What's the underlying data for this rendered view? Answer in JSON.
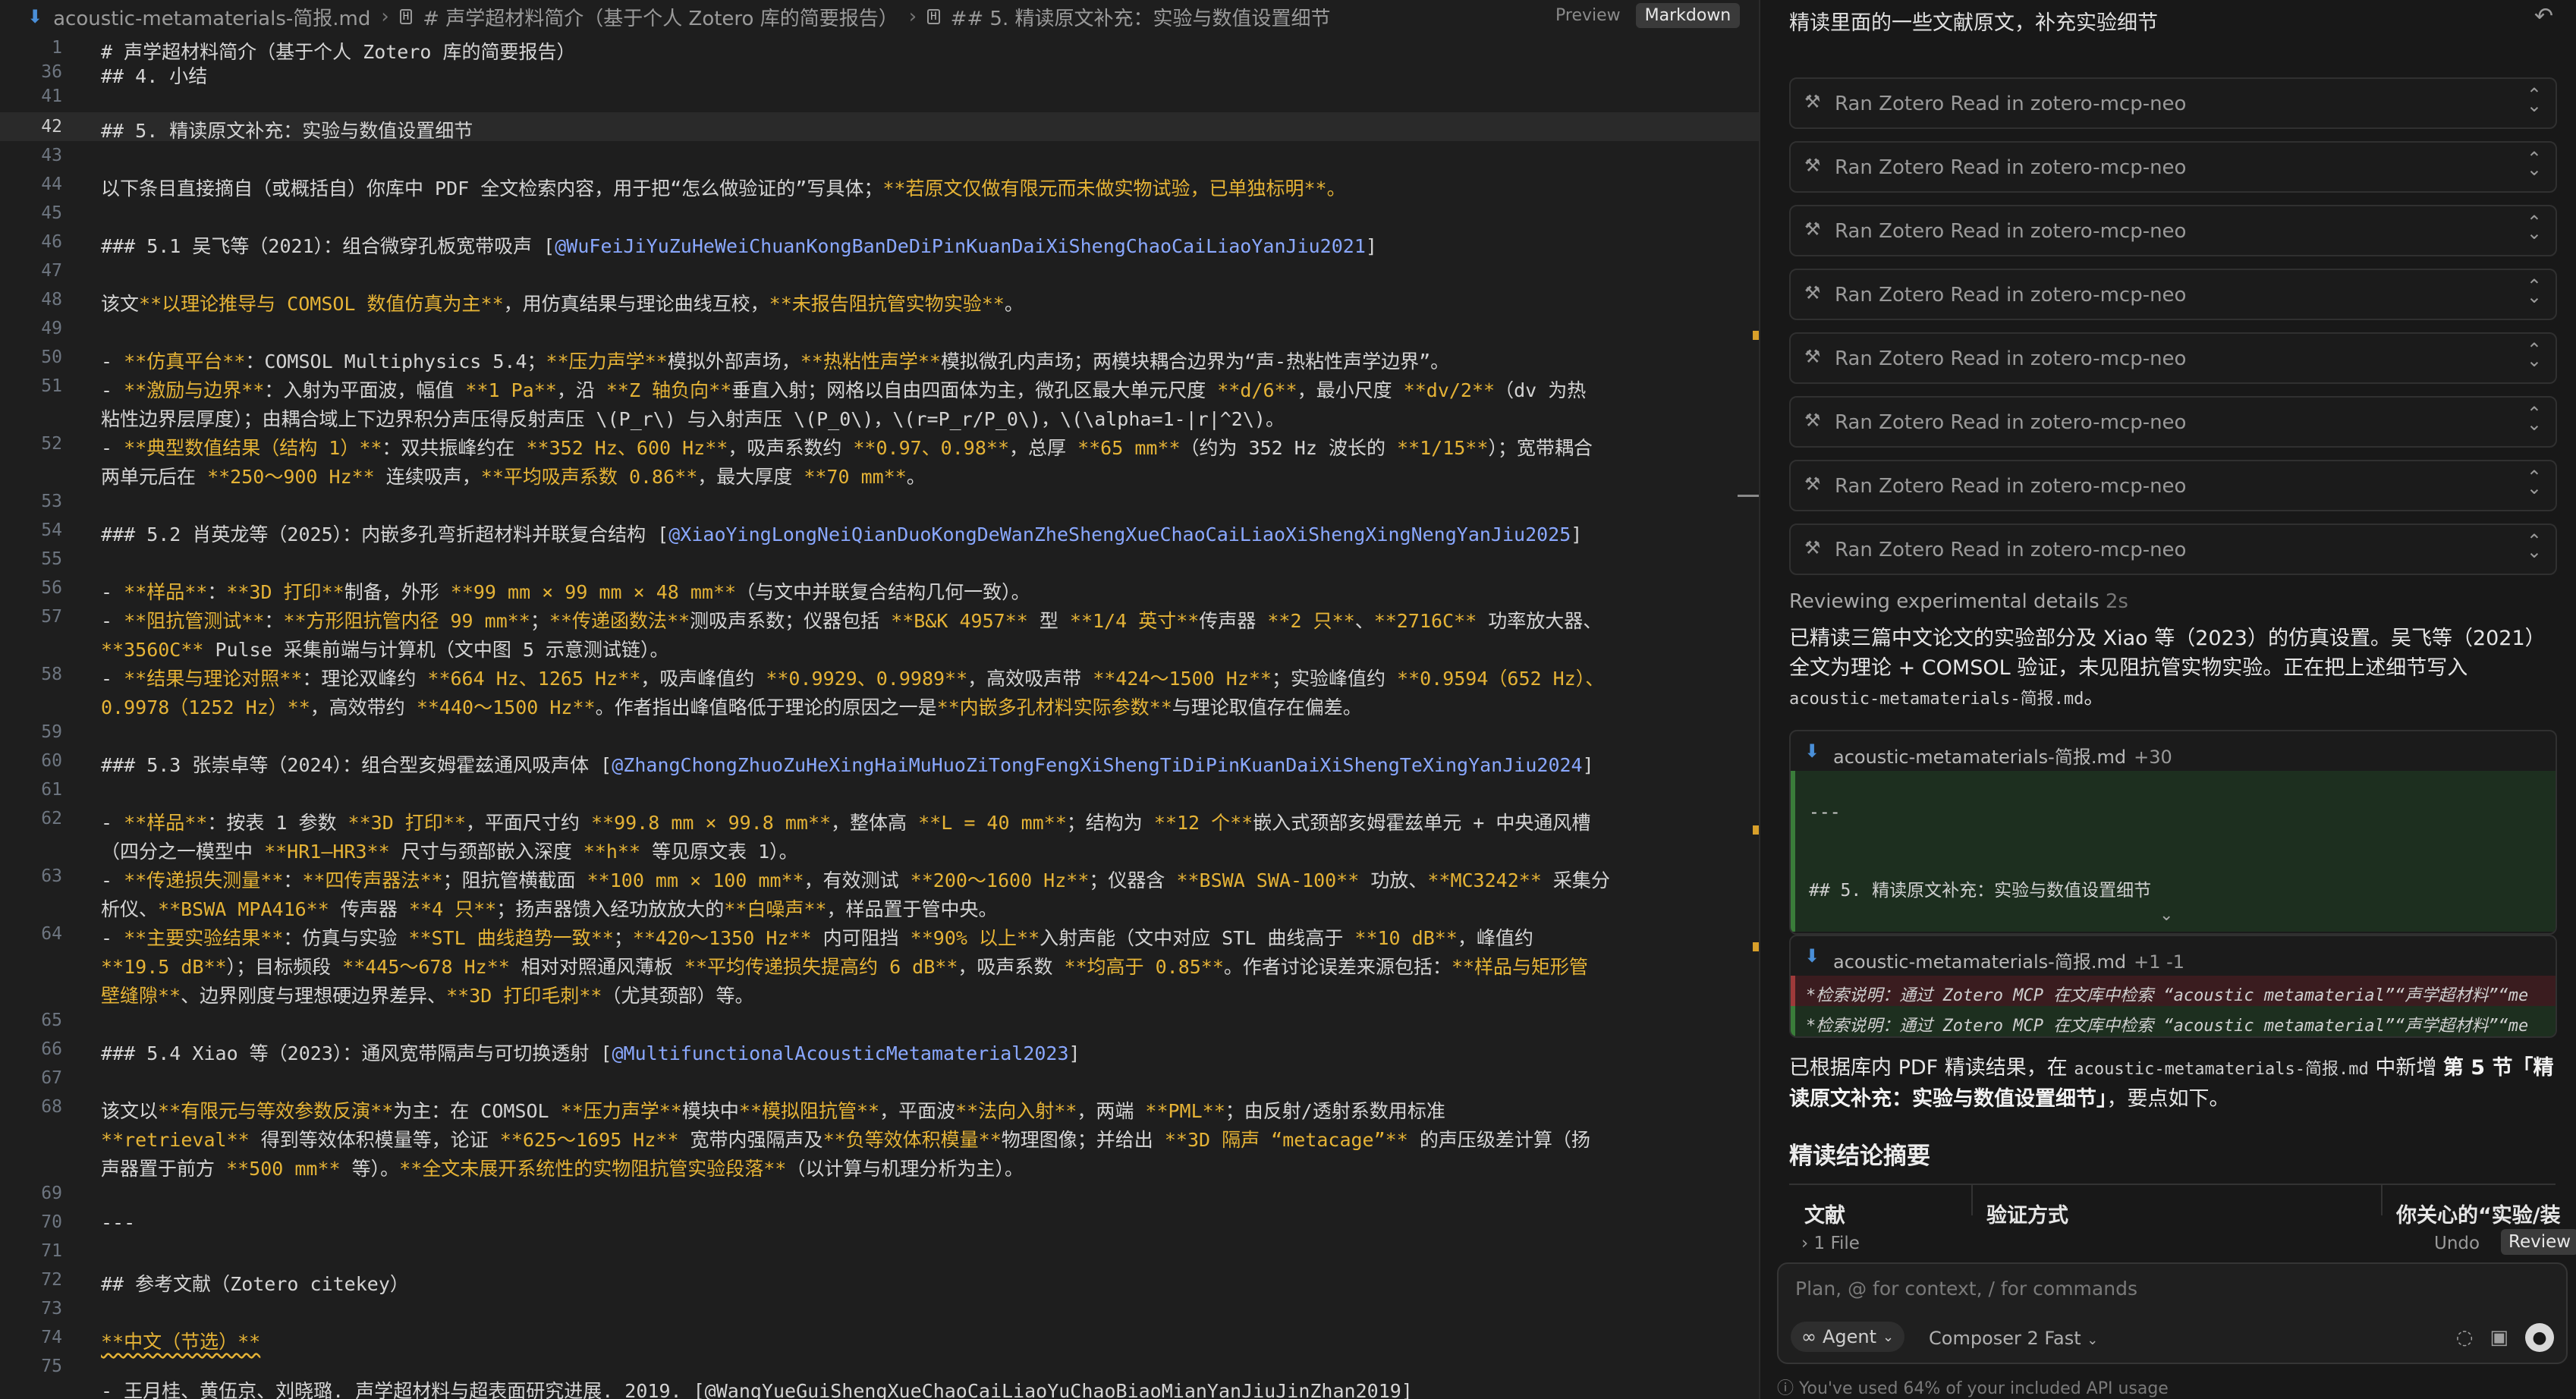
{
  "editor": {
    "breadcrumb": {
      "file": "acoustic-metamaterials-简报.md",
      "section1": "# 声学超材料简介（基于个人 Zotero 库的简要报告）",
      "section2": "## 5. 精读原文补充：实验与数值设置细节"
    },
    "view_toggle": {
      "preview": "Preview",
      "markdown": "Markdown"
    },
    "lines": {
      "l1": "# 声学超材料简介（基于个人 Zotero 库的简要报告）",
      "l36": "## 4. 小结",
      "l42": "## 5. 精读原文补充：实验与数值设置细节",
      "l44a": "以下条目直接摘自（或概括自）你库中 PDF 全文检索内容，用于把“怎么做验证的”写具体；",
      "l44b": "**若原文仅做有限元而未做实物试验，已单独标明**。",
      "l46a": "### 5.1 吴飞等（2021）：组合微穿孔板宽带吸声 [",
      "l46b": "@WuFeiJiYuZuHeWeiChuanKongBanDeDiPinKuanDaiXiShengChaoCaiLiaoYanJiu2021",
      "l46c": "]",
      "l48a": "该文",
      "l48b": "**以理论推导与 COMSOL 数值仿真为主**",
      "l48c": "，用仿真结果与理论曲线互校，",
      "l48d": "**未报告阻抗管实物实验**",
      "l48e": "。",
      "l50a": "- ",
      "l50b": "**仿真平台**",
      "l50c": "：COMSOL Multiphysics 5.4；",
      "l50d": "**压力声学**",
      "l50e": "模拟外部声场，",
      "l50f": "**热粘性声学**",
      "l50g": "模拟微孔内声场；两模块耦合边界为“声-热粘性声学边界”。",
      "l51a": "- ",
      "l51b": "**激励与边界**",
      "l51c": "：入射为平面波，幅值 ",
      "l51d": "**1 Pa**",
      "l51e": "，沿 ",
      "l51f": "**Z 轴负向**",
      "l51g": "垂直入射；网格以自由四面体为主，微孔区最大单元尺度 ",
      "l51h": "**d/6**",
      "l51i": "，最小尺度 ",
      "l51j": "**dv/2**",
      "l51k": "（dv 为热",
      "l51cont": "粘性边界层厚度）；由耦合域上下边界积分声压得反射声压 \\(P_r\\) 与入射声压 \\(P_0\\)，\\(r=P_r/P_0\\)，\\(\\alpha=1-|r|^2\\)。",
      "l52a": "- ",
      "l52b": "**典型数值结果（结构 1）**",
      "l52c": "：双共振峰约在 ",
      "l52d": "**352 Hz、600 Hz**",
      "l52e": "，吸声系数约 ",
      "l52f": "**0.97、0.98**",
      "l52g": "，总厚 ",
      "l52h": "**65 mm**",
      "l52i": "（约为 352 Hz 波长的 ",
      "l52j": "**1/15**",
      "l52k": "）；宽带耦合",
      "l52cont_a": "两单元后在 ",
      "l52cont_b": "**250～900 Hz**",
      "l52cont_c": " 连续吸声，",
      "l52cont_d": "**平均吸声系数 0.86**",
      "l52cont_e": "，最大厚度 ",
      "l52cont_f": "**70 mm**",
      "l52cont_g": "。",
      "l54a": "### 5.2 肖英龙等（2025）：内嵌多孔弯折超材料并联复合结构 [",
      "l54b": "@XiaoYingLongNeiQianDuoKongDeWanZheShengXueChaoCaiLiaoXiShengXingNengYanJiu2025",
      "l54c": "]",
      "l56a": "- ",
      "l56b": "**样品**",
      "l56c": "：",
      "l56d": "**3D 打印**",
      "l56e": "制备，外形 ",
      "l56f": "**99 mm × 99 mm × 48 mm**",
      "l56g": "（与文中并联复合结构几何一致）。",
      "l57a": "- ",
      "l57b": "**阻抗管测试**",
      "l57c": "：",
      "l57d": "**方形阻抗管内径 99 mm**",
      "l57e": "；",
      "l57f": "**传递函数法**",
      "l57g": "测吸声系数；仪器包括 ",
      "l57h": "**B&K 4957**",
      "l57i": " 型 ",
      "l57j": "**1/4 英寸**",
      "l57k": "传声器 ",
      "l57l": "**2 只**",
      "l57m": "、",
      "l57n": "**2716C**",
      "l57o": " 功率放大器、",
      "l57cont_a": "**3560C**",
      "l57cont_b": " Pulse 采集前端与计算机（文中图 5 示意测试链）。",
      "l58a": "- ",
      "l58b": "**结果与理论对照**",
      "l58c": "：理论双峰约 ",
      "l58d": "**664 Hz、1265 Hz**",
      "l58e": "，吸声峰值约 ",
      "l58f": "**0.9929、0.9989**",
      "l58g": "，高效吸声带 ",
      "l58h": "**424～1500 Hz**",
      "l58i": "；实验峰值约 ",
      "l58j": "**0.9594（652 Hz）、",
      "l58cont_a": "0.9978（1252 Hz）**",
      "l58cont_b": "，高效带约 ",
      "l58cont_c": "**440～1500 Hz**",
      "l58cont_d": "。作者指出峰值略低于理论的原因之一是",
      "l58cont_e": "**内嵌多孔材料实际参数**",
      "l58cont_f": "与理论取值存在偏差。",
      "l60a": "### 5.3 张崇卓等（2024）：组合型亥姆霍兹通风吸声体 [",
      "l60b": "@ZhangChongZhuoZuHeXingHaiMuHuoZiTongFengXiShengTiDiPinKuanDaiXiShengTeXingYanJiu2024",
      "l60c": "]",
      "l62a": "- ",
      "l62b": "**样品**",
      "l62c": "：按表 1 参数 ",
      "l62d": "**3D 打印**",
      "l62e": "，平面尺寸约 ",
      "l62f": "**99.8 mm × 99.8 mm**",
      "l62g": "，整体高 ",
      "l62h": "**L = 40 mm**",
      "l62i": "；结构为 ",
      "l62j": "**12 个**",
      "l62k": "嵌入式颈部亥姆霍兹单元 + 中央通风槽",
      "l62cont_a": "（四分之一模型中 ",
      "l62cont_b": "**HR1–HR3**",
      "l62cont_c": " 尺寸与颈部嵌入深度 ",
      "l62cont_d": "**h**",
      "l62cont_e": " 等见原文表 1）。",
      "l63a": "- ",
      "l63b": "**传递损失测量**",
      "l63c": "：",
      "l63d": "**四传声器法**",
      "l63e": "；阻抗管横截面 ",
      "l63f": "**100 mm × 100 mm**",
      "l63g": "，有效测试 ",
      "l63h": "**200～1600 Hz**",
      "l63i": "；仪器含 ",
      "l63j": "**BSWA SWA-100**",
      "l63k": " 功放、",
      "l63l": "**MC3242**",
      "l63m": " 采集分",
      "l63cont_a": "析仪、",
      "l63cont_b": "**BSWA MPA416**",
      "l63cont_c": " 传声器 ",
      "l63cont_d": "**4 只**",
      "l63cont_e": "；扬声器馈入经功放放大的",
      "l63cont_f": "**白噪声**",
      "l63cont_g": "，样品置于管中央。",
      "l64a": "- ",
      "l64b": "**主要实验结果**",
      "l64c": "：仿真与实验 ",
      "l64d": "**STL 曲线趋势一致**",
      "l64e": "；",
      "l64f": "**420～1350 Hz**",
      "l64g": " 内可阻挡 ",
      "l64h": "**90% 以上**",
      "l64i": "入射声能（文中对应 STL 曲线高于 ",
      "l64j": "**10 dB**",
      "l64k": "，峰值约",
      "l64cont_a": "**19.5 dB**",
      "l64cont_b": "）；目标频段 ",
      "l64cont_c": "**445～678 Hz**",
      "l64cont_d": " 相对对照通风薄板 ",
      "l64cont_e": "**平均传递损失提高约 6 dB**",
      "l64cont_f": "，吸声系数 ",
      "l64cont_g": "**均高于 0.85**",
      "l64cont_h": "。作者讨论误差来源包括：",
      "l64cont_i": "**样品与矩形管",
      "l64cont2_a": "壁缝隙**",
      "l64cont2_b": "、边界刚度与理想硬边界差异、",
      "l64cont2_c": "**3D 打印毛刺**",
      "l64cont2_d": "（尤其颈部）等。",
      "l66a": "### 5.4 Xiao 等（2023）：通风宽带隔声与可切换透射 [",
      "l66b": "@MultifunctionalAcousticMetamaterial2023",
      "l66c": "]",
      "l68a": "该文以",
      "l68b": "**有限元与等效参数反演**",
      "l68c": "为主：在 COMSOL ",
      "l68d": "**压力声学**",
      "l68e": "模块中",
      "l68f": "**模拟阻抗管**",
      "l68g": "，平面波",
      "l68h": "**法向入射**",
      "l68i": "，两端 ",
      "l68j": "**PML**",
      "l68k": "；由反射/透射系数用标准",
      "l68cont_a": "**retrieval**",
      "l68cont_b": " 得到等效体积模量等，论证 ",
      "l68cont_c": "**625～1695 Hz**",
      "l68cont_d": " 宽带内强隔声及",
      "l68cont_e": "**负等效体积模量**",
      "l68cont_f": "物理图像；并给出 ",
      "l68cont_g": "**3D 隔声 “metacage”**",
      "l68cont_h": " 的声压级差计算（扬",
      "l68cont2_a": "声器置于前方 ",
      "l68cont2_b": "**500 mm**",
      "l68cont2_c": " 等）。",
      "l68cont2_d": "**全文未展开系统性的实物阻抗管实验段落**",
      "l68cont2_e": "（以计算与机理分析为主）。",
      "l70": "---",
      "l72": "## 参考文献（Zotero citekey）",
      "l74": "**中文（节选）**",
      "l75": "- 王月桂、黄伍京、刘晓璐. 声学超材料与超表面研究进展. 2019. [@WangYueGuiShengXueChaoCaiLiaoYuChaoBiaoMianYanJiuJinZhan2019]"
    },
    "line_numbers": [
      "1",
      "36",
      "41",
      "42",
      "43",
      "44",
      "45",
      "46",
      "47",
      "48",
      "49",
      "50",
      "51",
      "52",
      "53",
      "54",
      "55",
      "56",
      "57",
      "58",
      "59",
      "60",
      "61",
      "62",
      "63",
      "64",
      "65",
      "66",
      "67",
      "68",
      "69",
      "70",
      "71",
      "72",
      "73",
      "74",
      "75"
    ]
  },
  "chat": {
    "title": "精读里面的一些文献原文，补充实验细节",
    "tool_calls": [
      "Ran Zotero Read in zotero-mcp-neo",
      "Ran Zotero Read in zotero-mcp-neo",
      "Ran Zotero Read in zotero-mcp-neo",
      "Ran Zotero Read in zotero-mcp-neo",
      "Ran Zotero Read in zotero-mcp-neo",
      "Ran Zotero Read in zotero-mcp-neo",
      "Ran Zotero Read in zotero-mcp-neo",
      "Ran Zotero Read in zotero-mcp-neo"
    ],
    "reviewing": "Reviewing experimental details",
    "reviewing_time": "2s",
    "para1_a": "已精读三篇中文论文的实验部分及 Xiao 等（2023）的仿真设置。吴飞等（2021）全文为理论 + COMSOL 验证，未见阻抗管实物实验。正在把上述细节写入 ",
    "para1_code": "acoustic-metamaterials-简报.md",
    "para1_b": "。",
    "diff1": {
      "file": "acoustic-metamaterials-简报.md",
      "stat": "+30",
      "line1": "---",
      "line2": "## 5. 精读原文补充：实验与数值设置细节"
    },
    "diff2": {
      "file": "acoustic-metamaterials-简报.md",
      "stat": "+1 -1",
      "del": "*检索说明：通过 Zotero MCP 在文库中检索 “acoustic metamaterial”“声学超材料”“me",
      "add": "*检索说明：通过 Zotero MCP 在文库中检索 “acoustic metamaterial”“声学超材料”“me"
    },
    "para2_a": "已根据库内 PDF 精读结果，在 ",
    "para2_code": "acoustic-metamaterials-简报.md",
    "para2_b": " 中新增 ",
    "para2_bold": "第 5 节「精读原文补充：实验与数值设置细节」",
    "para2_c": "，要点如下。",
    "summary_heading": "精读结论摘要",
    "table_headers": [
      "文献",
      "验证方式",
      "你关心的“实验/装"
    ],
    "files_label": "1 File",
    "undo": "Undo",
    "review": "Review",
    "input_placeholder": "Plan, @ for context, / for commands",
    "agent": "Agent",
    "model": "Composer 2 Fast",
    "usage": "You've used 64% of your included API usage"
  },
  "colors": {
    "accent": "#e5b336",
    "link": "#8aa8ff",
    "background": "#1e1e1e"
  }
}
